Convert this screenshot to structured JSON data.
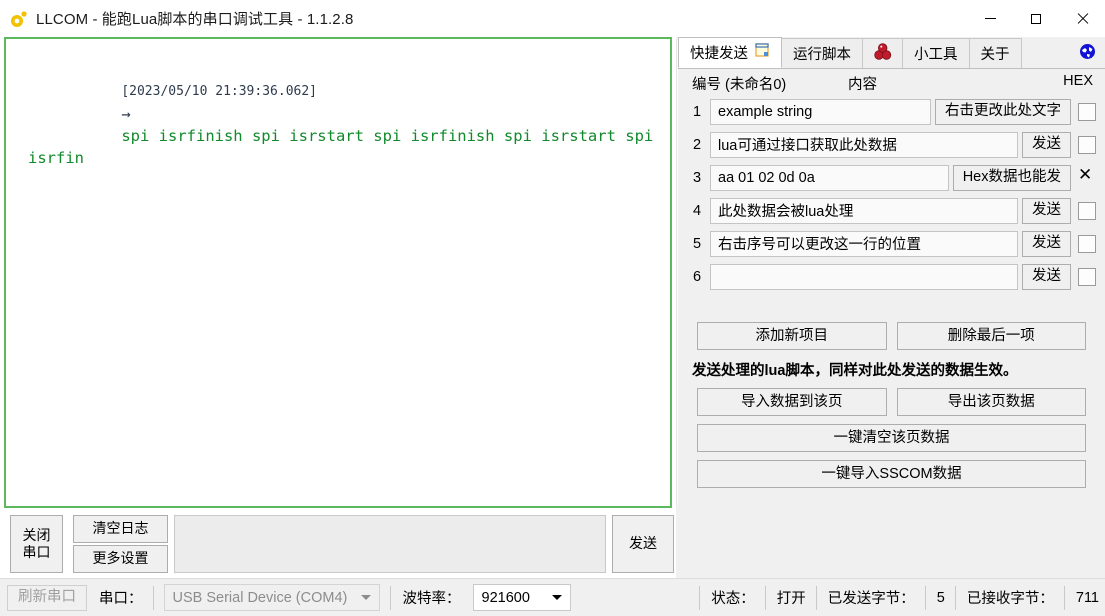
{
  "window": {
    "title": "LLCOM - 能跑Lua脚本的串口调试工具 - 1.1.2.8",
    "app_icon": "lua-comet-icon",
    "minimize": "–",
    "maximize": "□",
    "close": "✕"
  },
  "log": {
    "timestamp": "[2023/05/10 21:39:36.062]",
    "arrow": "→",
    "message": "spi isrfinish spi isrstart spi isrfinish spi isrstart spi isrfin",
    "text_color": "#128a2b",
    "border_color": "#5cb85c"
  },
  "left_controls": {
    "close_port_label": "关闭\n串口",
    "close_port_line1": "关闭",
    "close_port_line2": "串口",
    "clear_log_label": "清空日志",
    "more_settings_label": "更多设置",
    "send_input_value": "",
    "send_input_placeholder": "",
    "send_label": "发送"
  },
  "tabs": {
    "items": [
      {
        "label": "快捷发送",
        "icon": "note-page-icon",
        "active": true
      },
      {
        "label": "运行脚本",
        "icon": "",
        "active": false
      },
      {
        "label": "",
        "icon": "lua-balls-icon",
        "active": false
      },
      {
        "label": "小工具",
        "icon": "",
        "active": false
      },
      {
        "label": "关于",
        "icon": "",
        "active": false
      }
    ],
    "globe_icon": "globe-icon"
  },
  "table": {
    "header": {
      "number": "编号 (未命名0)",
      "content": "内容",
      "hex": "HEX"
    },
    "rows": [
      {
        "index": "1",
        "value": "example string",
        "button": "右击更改此处文字",
        "hex_checked": false
      },
      {
        "index": "2",
        "value": "lua可通过接口获取此处数据",
        "button": "发送",
        "hex_checked": false
      },
      {
        "index": "3",
        "value": "aa 01 02 0d 0a",
        "button": "Hex数据也能发",
        "hex_checked": true
      },
      {
        "index": "4",
        "value": "此处数据会被lua处理",
        "button": "发送",
        "hex_checked": false
      },
      {
        "index": "5",
        "value": "右击序号可以更改这一行的位置",
        "button": "发送",
        "hex_checked": false
      },
      {
        "index": "6",
        "value": "",
        "button": "发送",
        "hex_checked": false
      }
    ]
  },
  "actions": {
    "add_item": "添加新项目",
    "delete_last": "删除最后一项",
    "hint": "发送处理的lua脚本，同样对此处发送的数据生效。",
    "import_page": "导入数据到该页",
    "export_page": "导出该页数据",
    "clear_page": "一键清空该页数据",
    "import_sscom": "一键导入SSCOM数据"
  },
  "statusbar": {
    "refresh_ports": "刷新串口",
    "port_label": "串口：",
    "port_value": "USB Serial Device (COM4)",
    "baud_label": "波特率：",
    "baud_value": "921600",
    "state_label": "状态：",
    "state_value": "打开",
    "sent_label": "已发送字节：",
    "sent_value": "5",
    "recv_label": "已接收字节：",
    "recv_value": "711"
  }
}
